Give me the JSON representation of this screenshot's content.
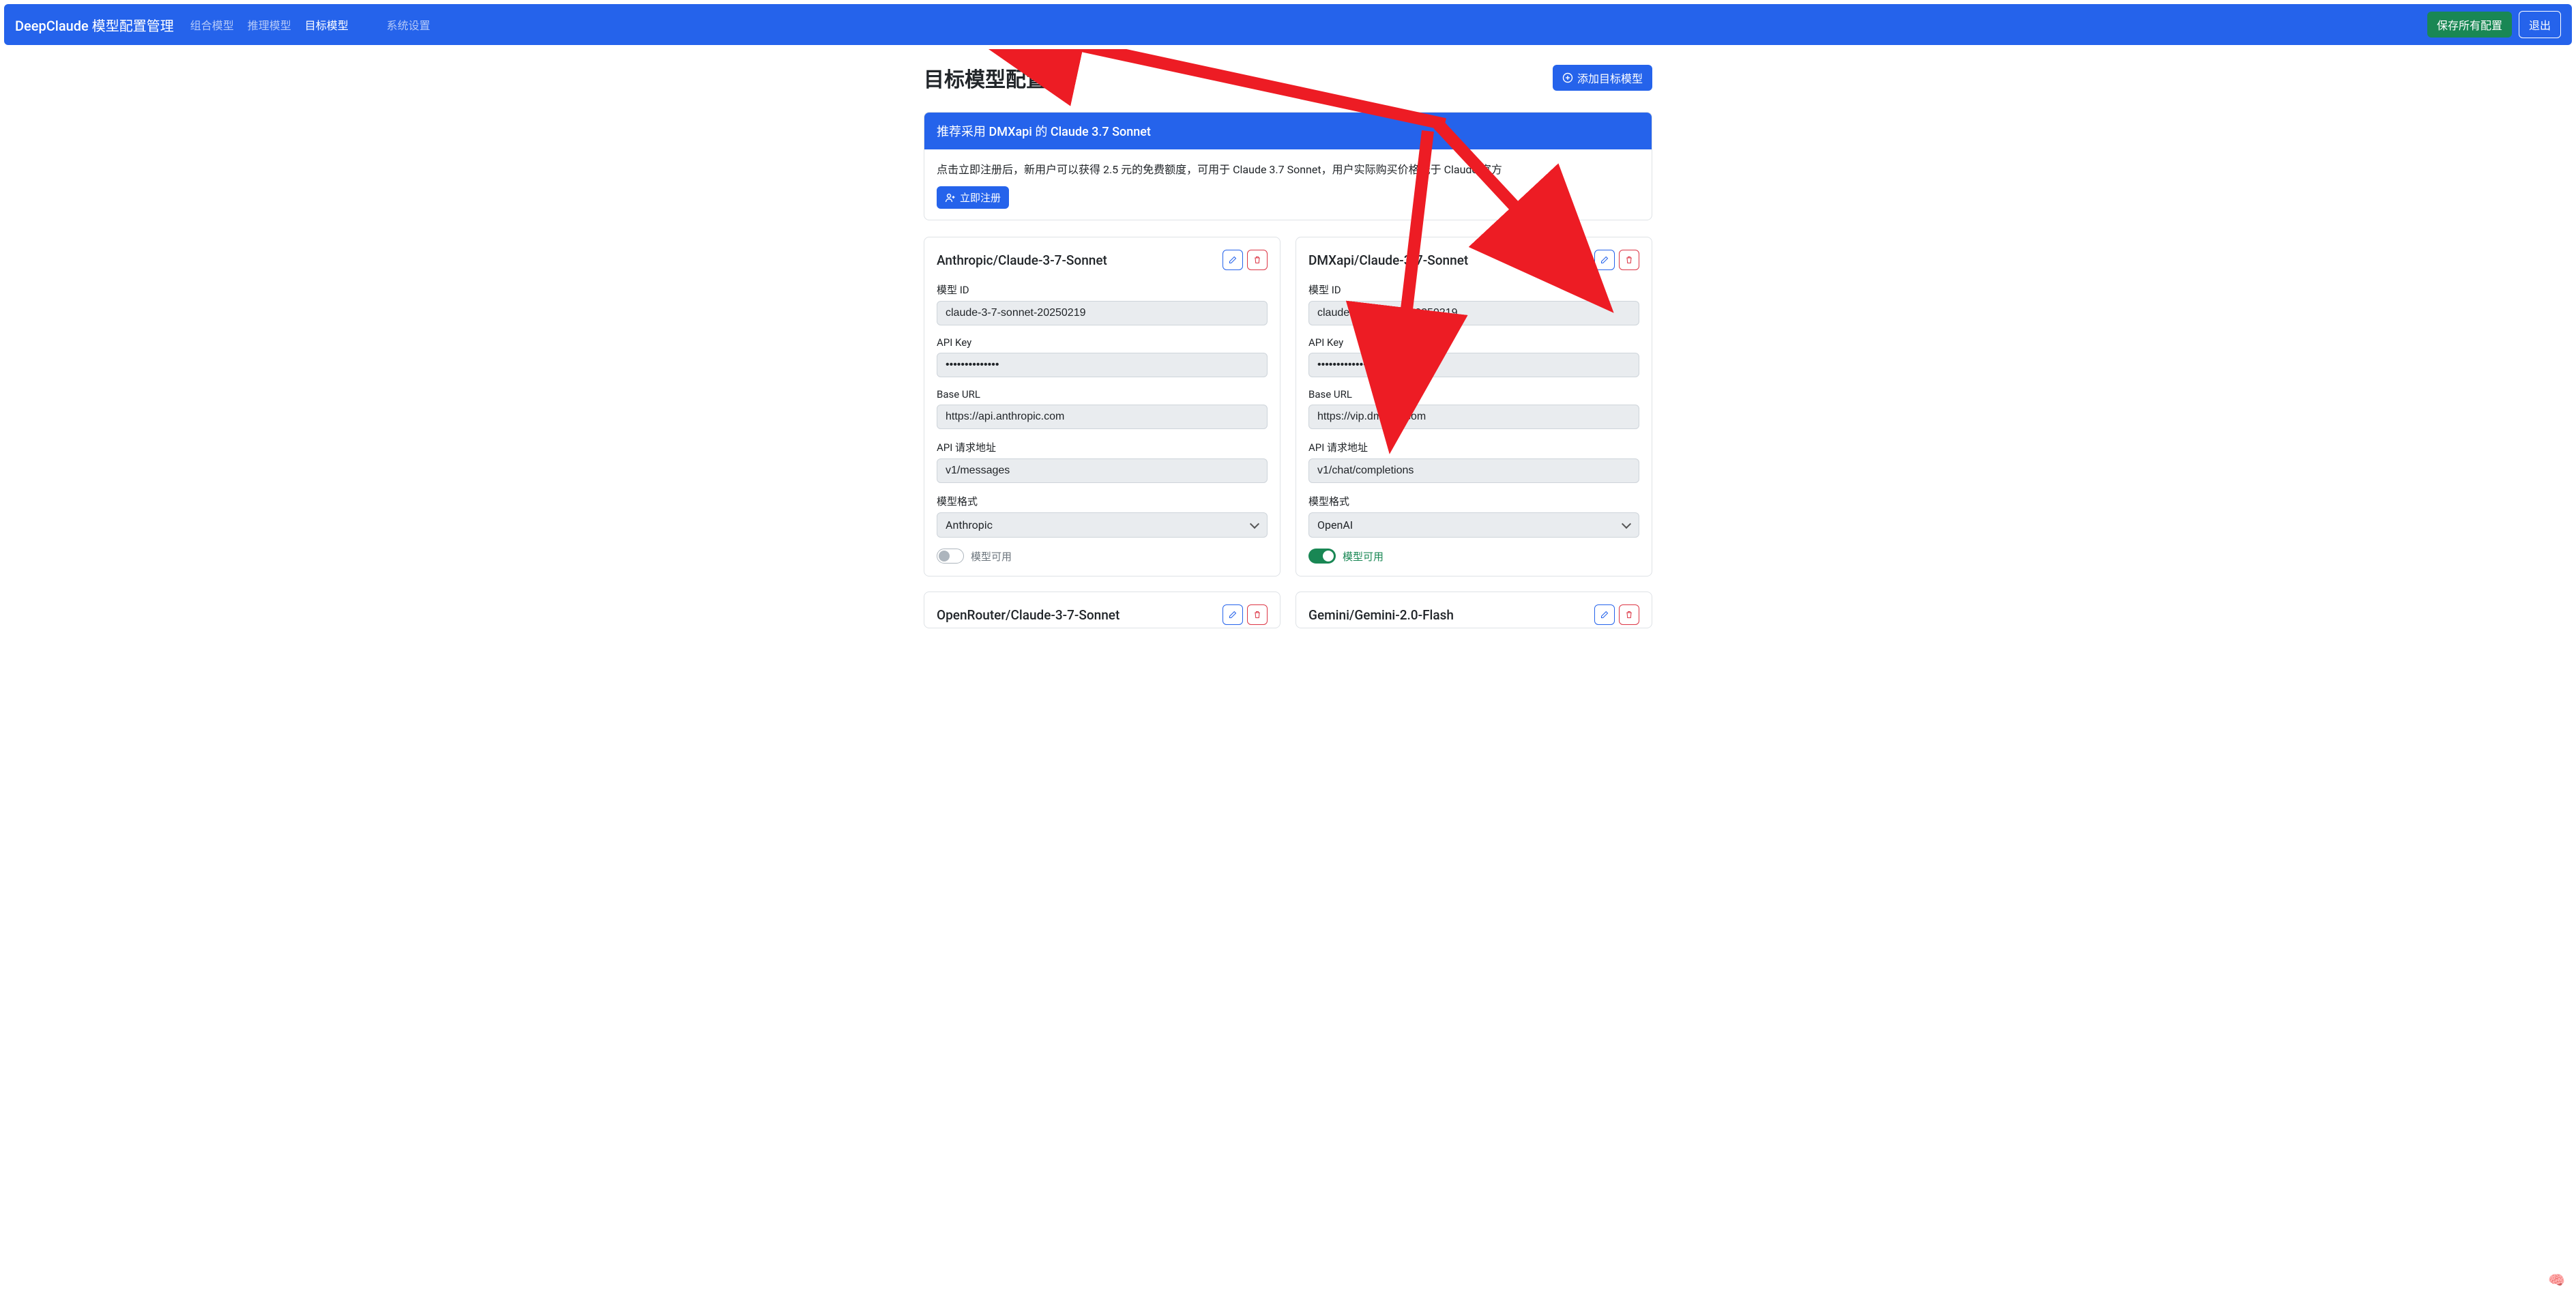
{
  "navbar": {
    "brand": "DeepClaude 模型配置管理",
    "links": [
      {
        "label": "组合模型",
        "active": false
      },
      {
        "label": "推理模型",
        "active": false
      },
      {
        "label": "目标模型",
        "active": true
      },
      {
        "label": "系统设置",
        "active": false
      }
    ],
    "save_all": "保存所有配置",
    "logout": "退出"
  },
  "page": {
    "title": "目标模型配置",
    "add_button": "添加目标模型"
  },
  "promo": {
    "header": "推荐采用 DMXapi 的 Claude 3.7 Sonnet",
    "desc": "点击立即注册后，新用户可以获得 2.5 元的免费额度，可用于 Claude 3.7 Sonnet，用户实际购买价格低于 Claude 官方",
    "register": "立即注册"
  },
  "labels": {
    "model_id": "模型 ID",
    "api_key": "API Key",
    "base_url": "Base URL",
    "api_path": "API 请求地址",
    "model_format": "模型格式",
    "model_available": "模型可用"
  },
  "models": [
    {
      "title": "Anthropic/Claude-3-7-Sonnet",
      "model_id": "claude-3-7-sonnet-20250219",
      "api_key": "••••••••••••••",
      "base_url": "https://api.anthropic.com",
      "api_path": "v1/messages",
      "format": "Anthropic",
      "enabled": false
    },
    {
      "title": "DMXapi/Claude-3-7-Sonnet",
      "model_id": "claude-3-7-sonnet-20250219",
      "api_key": "••••••••••••••",
      "base_url": "https://vip.dmxapi.com",
      "api_path": "v1/chat/completions",
      "format": "OpenAI",
      "enabled": true
    },
    {
      "title": "OpenRouter/Claude-3-7-Sonnet"
    },
    {
      "title": "Gemini/Gemini-2.0-Flash"
    }
  ]
}
